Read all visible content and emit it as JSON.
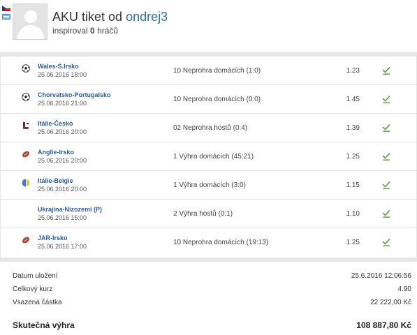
{
  "header": {
    "title_prefix": "AKU tiket od",
    "username": "ondrej3",
    "inspired_prefix": "inspiroval",
    "inspired_count": "0",
    "inspired_suffix": "hráčů"
  },
  "bets": [
    {
      "match": "Wales-S.Irsko",
      "date": "25.06.2016 18:00",
      "bet": "10 Neprohra domácích (1:0)",
      "odds": "1.23",
      "sport_icon": "football-icon"
    },
    {
      "match": "Chorvatsko-Portugalsko",
      "date": "25.06.2016 21:00",
      "bet": "10 Neprohra domácích (0:0)",
      "odds": "1.45",
      "sport_icon": "football-icon"
    },
    {
      "match": "Itálie-Česko",
      "date": "25.06.2016 20:00",
      "bet": "02 Neprohra hostů (0:4)",
      "odds": "1.39",
      "sport_icon": "ice-hockey-icon"
    },
    {
      "match": "Anglie-Irsko",
      "date": "25.06.2016 20:00",
      "bet": "1 Výhra domácích (45:21)",
      "odds": "1.25",
      "sport_icon": "rugby-icon"
    },
    {
      "match": "Itálie-Belgie",
      "date": "25.06.2016 20:00",
      "bet": "1 Výhra domácích (3:0)",
      "odds": "1.15",
      "sport_icon": "volleyball-icon"
    },
    {
      "match": "Ukrajina-Nizozemí (P)",
      "date": "25.06.2016 15:00",
      "bet": "2 Výhra hostů (0:1)",
      "odds": "1.10",
      "sport_icon": ""
    },
    {
      "match": "JAR-Irsko",
      "date": "25.06.2016 17:00",
      "bet": "10 Neprohra domácích (19:13)",
      "odds": "1.25",
      "sport_icon": "rugby-icon"
    }
  ],
  "summary": {
    "saved_label": "Datum uložení",
    "saved_value": "25.6.2016 12:06:56",
    "total_odds_label": "Celkový kurz",
    "total_odds_value": "4.90",
    "stake_label": "Vsazená částka",
    "stake_value": "22 222,00 Kč",
    "win_label": "Skutečná výhra",
    "win_value": "108 887,80 Kč"
  },
  "colors": {
    "link": "#2a5da8",
    "check": "#6aa84f",
    "divider": "#e6e6e6"
  }
}
